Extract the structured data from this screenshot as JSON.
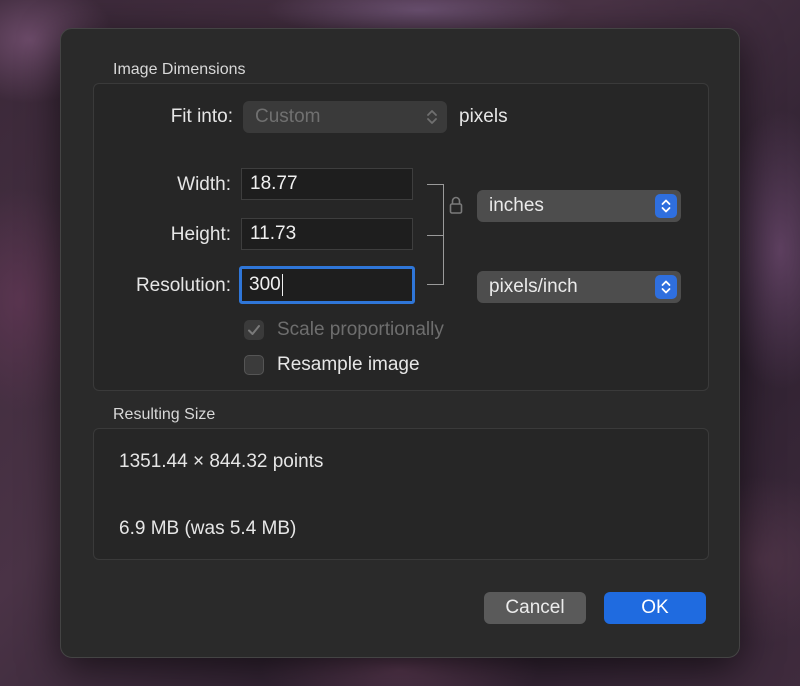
{
  "dialog": {
    "image_dimensions": {
      "title": "Image Dimensions",
      "fit_into_label": "Fit into:",
      "fit_into_value": "Custom",
      "fit_into_unit": "pixels",
      "width_label": "Width:",
      "width_value": "18.77",
      "height_label": "Height:",
      "height_value": "11.73",
      "resolution_label": "Resolution:",
      "resolution_value": "300",
      "size_unit": "inches",
      "resolution_unit": "pixels/inch",
      "scale_proportionally_label": "Scale proportionally",
      "scale_proportionally_checked": true,
      "scale_proportionally_enabled": false,
      "resample_label": "Resample image",
      "resample_checked": false
    },
    "resulting_size": {
      "title": "Resulting Size",
      "points": "1351.44 × 844.32 points",
      "file_size": "6.9 MB (was 5.4 MB)"
    },
    "buttons": {
      "cancel_label": "Cancel",
      "ok_label": "OK"
    }
  },
  "icons": {
    "lock": "lock-icon",
    "popup_chevron": "chevron-up-down-icon",
    "checkmark": "checkmark-icon"
  },
  "colors": {
    "accent": "#1f6be0",
    "focus_ring": "#2f76d8",
    "dialog_bg": "#2a2a2a"
  }
}
